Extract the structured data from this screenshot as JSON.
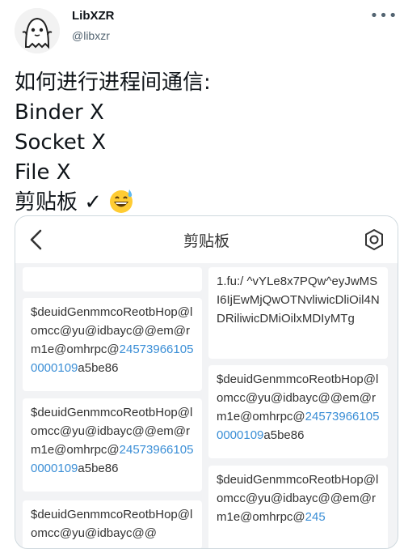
{
  "author": {
    "name": "LibXZR",
    "handle": "@libxzr"
  },
  "more_icon": "•••",
  "tweet": {
    "lines": [
      "如何进行进程间通信:",
      "Binder X",
      "Socket X",
      "File X",
      "剪贴板 ✓"
    ],
    "emoji": "grinning-face-with-sweat"
  },
  "clipboard_app": {
    "title": "剪贴板",
    "left_column": [
      {
        "text": "",
        "link": "",
        "suffix": ""
      },
      {
        "text": "$deuidGenmmcoReotbHop@lomcc@yu@idbayc@@em@rm1e@omhrpc@",
        "link": "245739661050000109",
        "suffix": "a5be86"
      },
      {
        "text": "$deuidGenmmcoReotbHop@lomcc@yu@idbayc@@em@rm1e@omhrpc@",
        "link": "245739661050000109",
        "suffix": "a5be86"
      },
      {
        "text": "$deuidGenmmcoReotbHop@lomcc@yu@idbayc@@",
        "link": "",
        "suffix": ""
      }
    ],
    "right_column": [
      {
        "text": "1.fu:/ ^vYLe8x7PQw^eyJwMSI6IjEwMjQwOTNvliwicDliOil4NDRiliwicDMiOilxMDIyMTg",
        "link": "",
        "suffix": ""
      },
      {
        "text": "$deuidGenmmcoReotbHop@lomcc@yu@idbayc@@em@rm1e@omhrpc@",
        "link": "245739661050000109",
        "suffix": "a5be86"
      },
      {
        "text": "$deuidGenmmcoReotbHop@lomcc@yu@idbayc@@em@rm1e@omhrpc@",
        "link": "245",
        "suffix": ""
      }
    ]
  }
}
